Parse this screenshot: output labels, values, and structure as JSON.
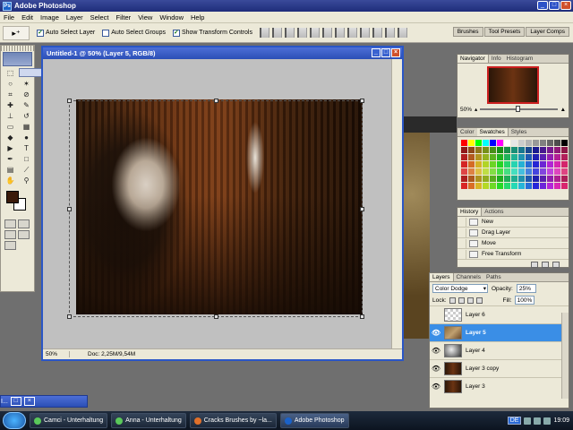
{
  "app": {
    "title": "Adobe Photoshop",
    "icon": "ps-icon"
  },
  "window_buttons": [
    "_",
    "□",
    "×"
  ],
  "menu": [
    "File",
    "Edit",
    "Image",
    "Layer",
    "Select",
    "Filter",
    "View",
    "Window",
    "Help"
  ],
  "options": {
    "tool_label": "▸⁺",
    "auto_select_layer": "Auto Select Layer",
    "auto_select_groups": "Auto Select Groups",
    "show_transform": "Show Transform Controls"
  },
  "well_tabs": [
    "Brushes",
    "Tool Presets",
    "Layer Comps"
  ],
  "document": {
    "title": "Untitled-1 @ 50% (Layer 5, RGB/8)",
    "zoom": "50%",
    "doc_size": "Doc: 2,25M/9,54M"
  },
  "navigator": {
    "tabs": [
      "Navigator",
      "Info",
      "Histogram"
    ],
    "zoom": "50%",
    "zoom_level": 0.5
  },
  "swatches_panel": {
    "tabs": [
      "Color",
      "Swatches",
      "Styles"
    ]
  },
  "history": {
    "tabs": [
      "History",
      "Actions"
    ],
    "items": [
      "New",
      "Drag Layer",
      "Move",
      "Free Transform"
    ]
  },
  "layers": {
    "tabs": [
      "Layers",
      "Channels",
      "Paths"
    ],
    "blend_mode": "Color Dodge",
    "opacity_label": "Opacity:",
    "opacity": "25%",
    "lock_label": "Lock:",
    "fill_label": "Fill:",
    "fill": "100%",
    "items": [
      {
        "name": "Layer 6",
        "visible": false,
        "thumb": "checker",
        "active": false
      },
      {
        "name": "Layer 5",
        "visible": true,
        "thumb": "texture",
        "active": true
      },
      {
        "name": "Layer 4",
        "visible": true,
        "thumb": "bw",
        "active": false
      },
      {
        "name": "Layer 3 copy",
        "visible": true,
        "thumb": "photo",
        "active": false
      },
      {
        "name": "Layer 3",
        "visible": true,
        "thumb": "photo",
        "active": false
      }
    ]
  },
  "minimized_doc": {
    "label": "I..."
  },
  "taskbar": {
    "tasks": [
      {
        "label": "Camci - Unterhaltung",
        "icon_color": "#5ac85a"
      },
      {
        "label": "Anna - Unterhaltung",
        "icon_color": "#5ac85a"
      },
      {
        "label": "Cracks Brushes by ~la...",
        "icon_color": "#e0702a"
      },
      {
        "label": "Adobe Photoshop",
        "icon_color": "#1a62c9"
      }
    ],
    "lang": "DE",
    "clock": "19:09"
  },
  "colors": {
    "swatches": [
      "#ff0000",
      "#ffff00",
      "#00ff00",
      "#00ffff",
      "#0000ff",
      "#ff00ff",
      "#ffffff",
      "#e6e6e6",
      "#cccccc",
      "#b3b3b3",
      "#999999",
      "#808080",
      "#666666",
      "#4d4d4d",
      "#000000"
    ]
  }
}
